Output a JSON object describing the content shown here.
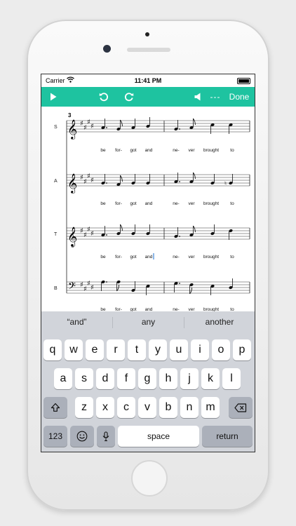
{
  "status": {
    "carrier": "Carrier",
    "time": "11:41 PM"
  },
  "toolbar": {
    "play_icon": "play-icon",
    "undo_icon": "undo-icon",
    "redo_icon": "redo-icon",
    "speaker_icon": "speaker-icon",
    "dashes": "---",
    "done_label": "Done",
    "accent": "#1ec3a0"
  },
  "score": {
    "measure_number": "3",
    "parts": [
      {
        "label": "S",
        "lyrics": [
          "be",
          "for-",
          "got",
          "and",
          "ne-",
          "ver",
          "brought",
          "to"
        ]
      },
      {
        "label": "A",
        "lyrics": [
          "be",
          "for-",
          "got",
          "and",
          "ne-",
          "ver",
          "brought",
          "to"
        ]
      },
      {
        "label": "T",
        "lyrics": [
          "be",
          "for-",
          "got",
          "and",
          "ne-",
          "ver",
          "brought",
          "to"
        ]
      },
      {
        "label": "B",
        "lyrics": [
          "be",
          "for-",
          "got",
          "and",
          "ne-",
          "ver",
          "brought",
          "to"
        ]
      }
    ]
  },
  "keyboard": {
    "suggestions": [
      "“and”",
      "any",
      "another"
    ],
    "row1": [
      "q",
      "w",
      "e",
      "r",
      "t",
      "y",
      "u",
      "i",
      "o",
      "p"
    ],
    "row2": [
      "a",
      "s",
      "d",
      "f",
      "g",
      "h",
      "j",
      "k",
      "l"
    ],
    "row3": [
      "z",
      "x",
      "c",
      "v",
      "b",
      "n",
      "m"
    ],
    "shift_icon": "shift-icon",
    "delete_icon": "backspace-icon",
    "numbers_label": "123",
    "emoji_icon": "emoji-icon",
    "mic_icon": "microphone-icon",
    "space_label": "space",
    "return_label": "return"
  }
}
